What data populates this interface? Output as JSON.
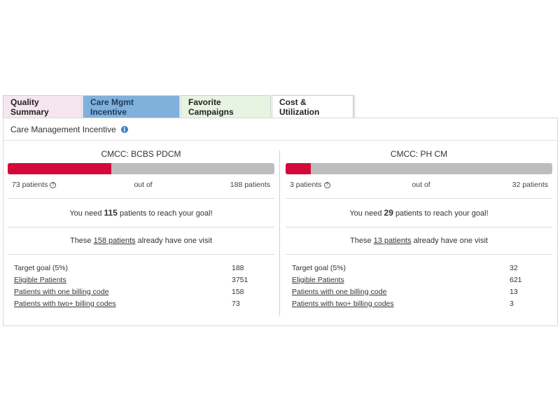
{
  "tabs": [
    {
      "label": "Quality Summary"
    },
    {
      "label": "Care Mgmt Incentive"
    },
    {
      "label": "Favorite Campaigns"
    },
    {
      "label": "Cost & Utilization"
    }
  ],
  "panel": {
    "title": "Care Management Incentive"
  },
  "programs": [
    {
      "title": "CMCC: BCBS PDCM",
      "progress_fraction": 0.388,
      "current": "73 patients",
      "out_of": "out of",
      "goal": "188 patients",
      "need_prefix": "You need",
      "need_count": "115",
      "need_suffix": "patients to reach your goal!",
      "visit_prefix": "These",
      "visit_link": "158 patients",
      "visit_suffix": "already have one visit",
      "stats": [
        {
          "label": "Target goal (5%)",
          "value": "188"
        },
        {
          "label": "Eligible Patients",
          "value": "3751"
        },
        {
          "label": "Patients with one billing code",
          "value": "158"
        },
        {
          "label": "Patients with two+ billing codes",
          "value": "73"
        }
      ]
    },
    {
      "title": "CMCC: PH CM",
      "progress_fraction": 0.094,
      "current": "3 patients",
      "out_of": "out of",
      "goal": "32 patients",
      "need_prefix": "You need",
      "need_count": "29",
      "need_suffix": "patients to reach your goal!",
      "visit_prefix": "These",
      "visit_link": "13 patients",
      "visit_suffix": "already have one visit",
      "stats": [
        {
          "label": "Target goal (5%)",
          "value": "32"
        },
        {
          "label": "Eligible Patients",
          "value": "621"
        },
        {
          "label": "Patients with one billing code",
          "value": "13"
        },
        {
          "label": "Patients with two+ billing codes",
          "value": "3"
        }
      ]
    }
  ],
  "colors": {
    "progress_fill": "#d3093c",
    "progress_track": "#bdbdbd",
    "tab_quality": "#f6e6ef",
    "tab_care_mgmt": "#80b1dc",
    "tab_favorites": "#e7f4e1",
    "tab_cost": "#ffffff"
  },
  "icons": {
    "info": "info-icon",
    "help": "question-circle-icon"
  }
}
